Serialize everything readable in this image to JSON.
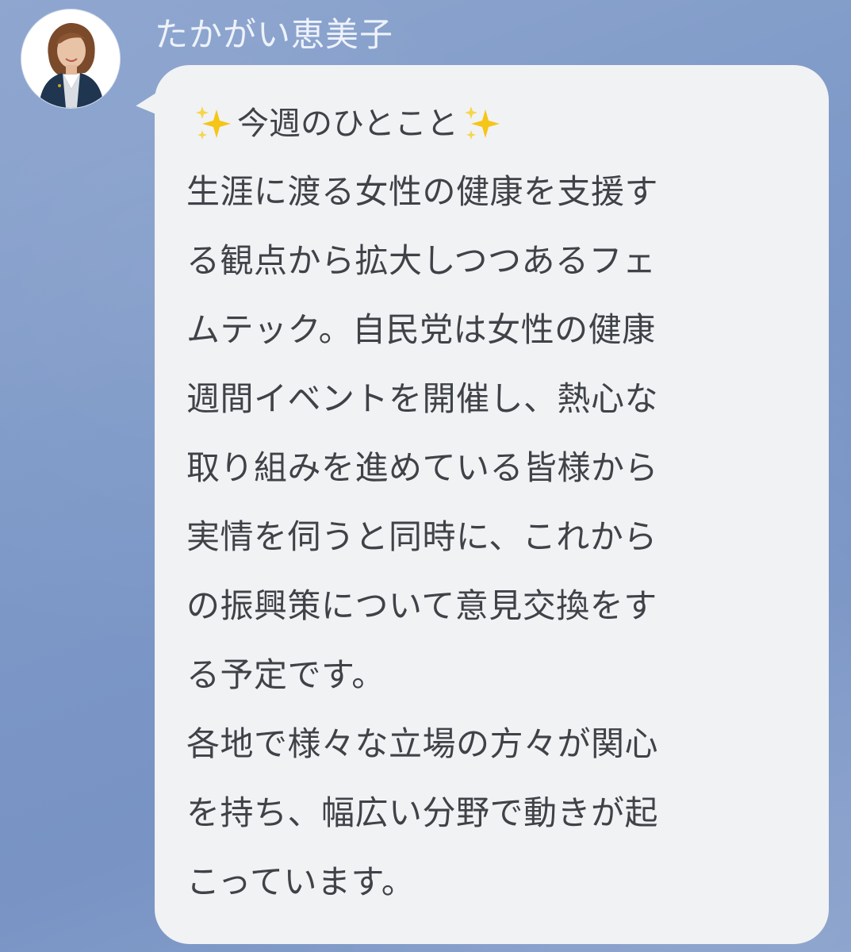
{
  "chat": {
    "sender_name": "たかがい恵美子",
    "avatar_icon": "profile-photo-avatar",
    "message": {
      "heading_text": "今週のひとこと",
      "heading_emoji": "sparkles",
      "lines": [
        "生涯に渡る女性の健康を支援す",
        "る観点から拡大しつつあるフェ",
        "ムテック。自民党は女性の健康",
        "週間イベントを開催し、熱心な",
        "取り組みを進めている皆様から",
        "実情を伺うと同時に、これから",
        "の振興策について意見交換をす",
        "る予定です。",
        "各地で様々な立場の方々が関心",
        "を持ち、幅広い分野で動きが起",
        "こっています。"
      ]
    }
  },
  "colors": {
    "background": "#7f9ac8",
    "bubble": "#f1f2f4",
    "text": "#3f4247",
    "name_text": "#eef2fa",
    "sparkle": "#f5c518"
  }
}
